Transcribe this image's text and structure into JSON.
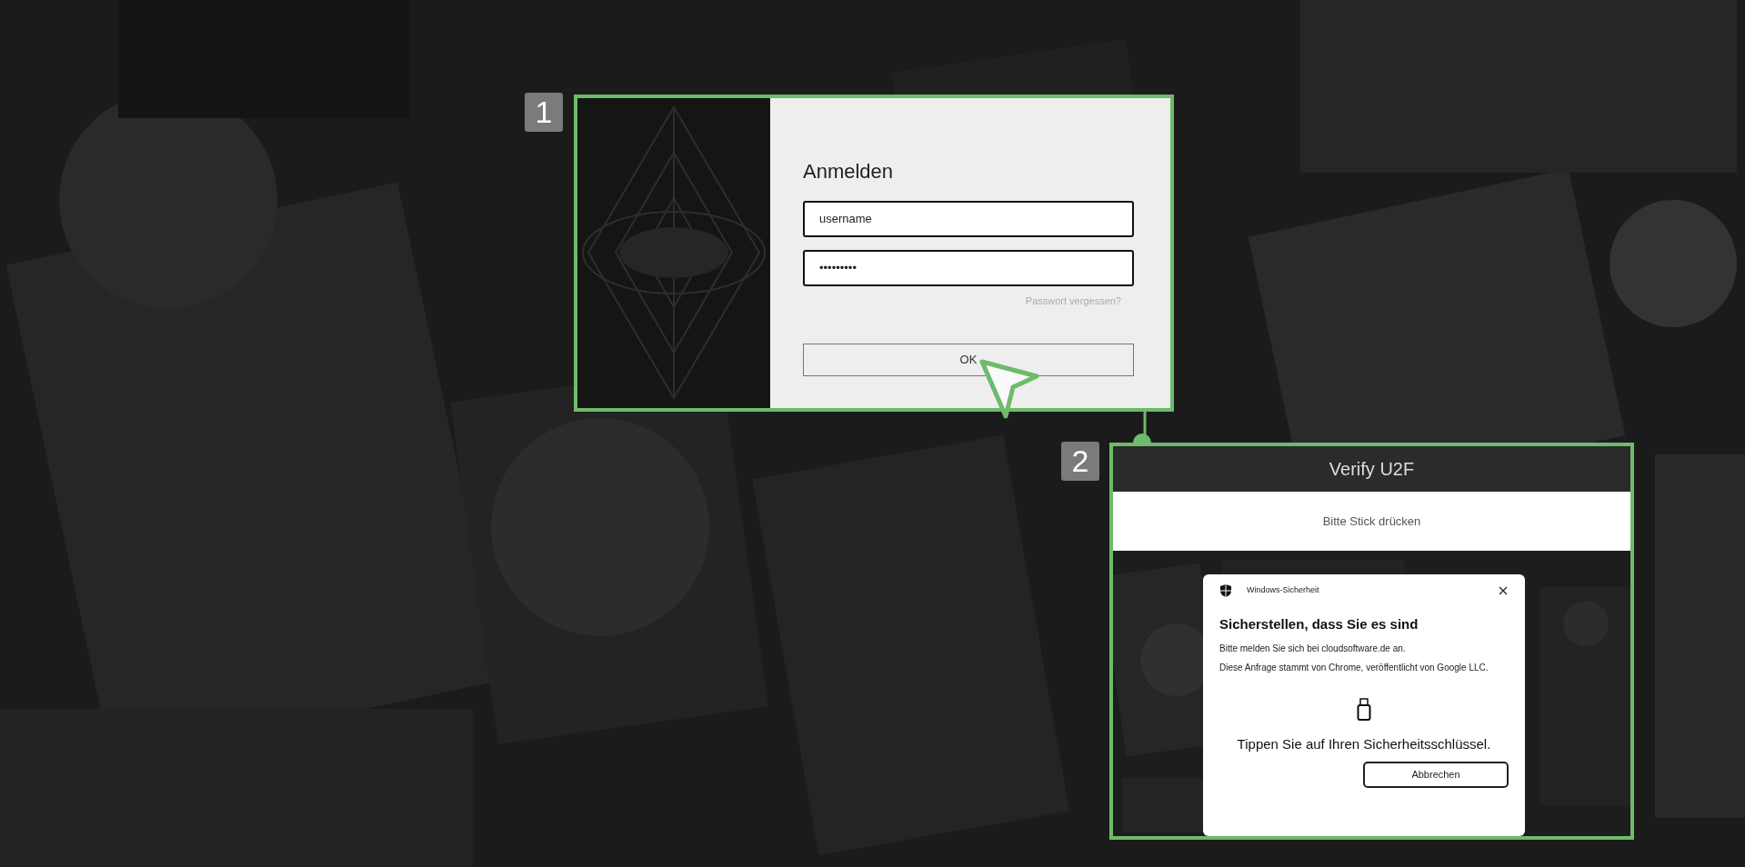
{
  "login": {
    "step": "1",
    "title": "Anmelden",
    "username": "username",
    "password": "•••••••••",
    "forgot_link": "Passwort vergessen?",
    "ok_button": "OK"
  },
  "u2f": {
    "step": "2",
    "title": "Verify U2F",
    "message": "Bitte Stick drücken",
    "dialog": {
      "app": "Windows-Sicherheit",
      "heading": "Sicherstellen, dass Sie es sind",
      "line_1": "Bitte melden Sie sich bei cloudsoftware.de an.",
      "line_2": "Diese Anfrage stammt von Chrome, veröffentlicht von Google LLC.",
      "prompt": "Tippen Sie auf Ihren Sicherheitsschlüssel.",
      "cancel_button": "Abbrechen"
    }
  }
}
